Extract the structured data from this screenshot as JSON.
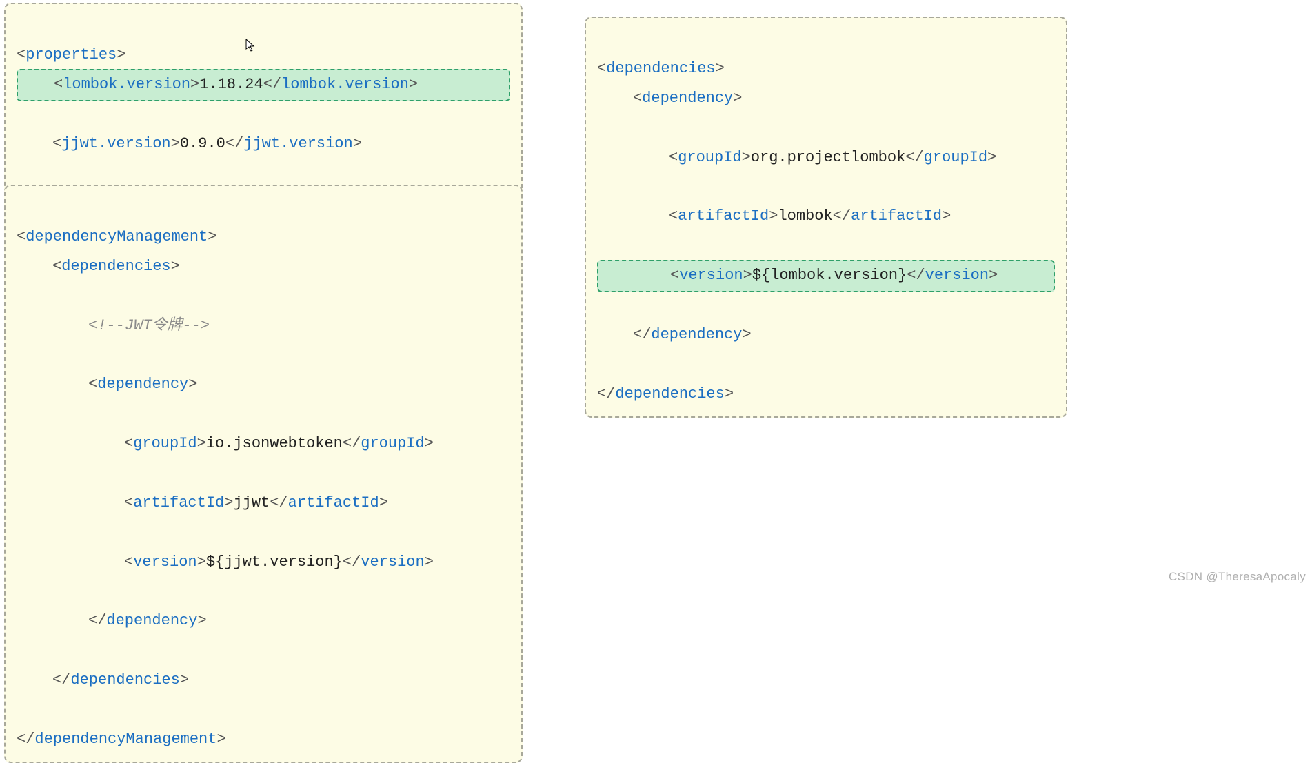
{
  "properties": {
    "open": "properties",
    "lombok": {
      "tag": "lombok.version",
      "value": "1.18.24"
    },
    "jjwt": {
      "tag": "jjwt.version",
      "value": "0.9.0"
    }
  },
  "depmgmt": {
    "root": "dependencyManagement",
    "deps": "dependencies",
    "comment": "<!--JWT令牌-->",
    "dep": {
      "tag": "dependency",
      "groupId": {
        "tag": "groupId",
        "value": "io.jsonwebtoken"
      },
      "artifactId": {
        "tag": "artifactId",
        "value": "jjwt"
      },
      "version": {
        "tag": "version",
        "value": "${jjwt.version}"
      }
    }
  },
  "deps": {
    "root": "dependencies",
    "dep": {
      "tag": "dependency",
      "groupId": {
        "tag": "groupId",
        "value": "org.projectlombok"
      },
      "artifactId": {
        "tag": "artifactId",
        "value": "lombok"
      },
      "version": {
        "tag": "version",
        "value": "${lombok.version}"
      }
    }
  },
  "watermark": "CSDN @TheresaApocaly"
}
